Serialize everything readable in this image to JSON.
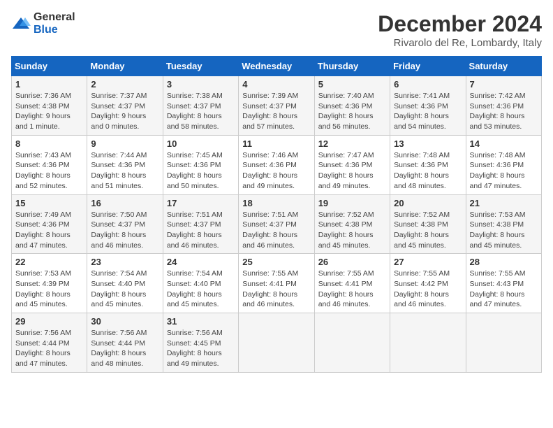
{
  "header": {
    "logo_general": "General",
    "logo_blue": "Blue",
    "title": "December 2024",
    "subtitle": "Rivarolo del Re, Lombardy, Italy"
  },
  "calendar": {
    "columns": [
      "Sunday",
      "Monday",
      "Tuesday",
      "Wednesday",
      "Thursday",
      "Friday",
      "Saturday"
    ],
    "weeks": [
      [
        {
          "day": "1",
          "sunrise": "Sunrise: 7:36 AM",
          "sunset": "Sunset: 4:38 PM",
          "daylight": "Daylight: 9 hours and 1 minute."
        },
        {
          "day": "2",
          "sunrise": "Sunrise: 7:37 AM",
          "sunset": "Sunset: 4:37 PM",
          "daylight": "Daylight: 9 hours and 0 minutes."
        },
        {
          "day": "3",
          "sunrise": "Sunrise: 7:38 AM",
          "sunset": "Sunset: 4:37 PM",
          "daylight": "Daylight: 8 hours and 58 minutes."
        },
        {
          "day": "4",
          "sunrise": "Sunrise: 7:39 AM",
          "sunset": "Sunset: 4:37 PM",
          "daylight": "Daylight: 8 hours and 57 minutes."
        },
        {
          "day": "5",
          "sunrise": "Sunrise: 7:40 AM",
          "sunset": "Sunset: 4:36 PM",
          "daylight": "Daylight: 8 hours and 56 minutes."
        },
        {
          "day": "6",
          "sunrise": "Sunrise: 7:41 AM",
          "sunset": "Sunset: 4:36 PM",
          "daylight": "Daylight: 8 hours and 54 minutes."
        },
        {
          "day": "7",
          "sunrise": "Sunrise: 7:42 AM",
          "sunset": "Sunset: 4:36 PM",
          "daylight": "Daylight: 8 hours and 53 minutes."
        }
      ],
      [
        {
          "day": "8",
          "sunrise": "Sunrise: 7:43 AM",
          "sunset": "Sunset: 4:36 PM",
          "daylight": "Daylight: 8 hours and 52 minutes."
        },
        {
          "day": "9",
          "sunrise": "Sunrise: 7:44 AM",
          "sunset": "Sunset: 4:36 PM",
          "daylight": "Daylight: 8 hours and 51 minutes."
        },
        {
          "day": "10",
          "sunrise": "Sunrise: 7:45 AM",
          "sunset": "Sunset: 4:36 PM",
          "daylight": "Daylight: 8 hours and 50 minutes."
        },
        {
          "day": "11",
          "sunrise": "Sunrise: 7:46 AM",
          "sunset": "Sunset: 4:36 PM",
          "daylight": "Daylight: 8 hours and 49 minutes."
        },
        {
          "day": "12",
          "sunrise": "Sunrise: 7:47 AM",
          "sunset": "Sunset: 4:36 PM",
          "daylight": "Daylight: 8 hours and 49 minutes."
        },
        {
          "day": "13",
          "sunrise": "Sunrise: 7:48 AM",
          "sunset": "Sunset: 4:36 PM",
          "daylight": "Daylight: 8 hours and 48 minutes."
        },
        {
          "day": "14",
          "sunrise": "Sunrise: 7:48 AM",
          "sunset": "Sunset: 4:36 PM",
          "daylight": "Daylight: 8 hours and 47 minutes."
        }
      ],
      [
        {
          "day": "15",
          "sunrise": "Sunrise: 7:49 AM",
          "sunset": "Sunset: 4:36 PM",
          "daylight": "Daylight: 8 hours and 47 minutes."
        },
        {
          "day": "16",
          "sunrise": "Sunrise: 7:50 AM",
          "sunset": "Sunset: 4:37 PM",
          "daylight": "Daylight: 8 hours and 46 minutes."
        },
        {
          "day": "17",
          "sunrise": "Sunrise: 7:51 AM",
          "sunset": "Sunset: 4:37 PM",
          "daylight": "Daylight: 8 hours and 46 minutes."
        },
        {
          "day": "18",
          "sunrise": "Sunrise: 7:51 AM",
          "sunset": "Sunset: 4:37 PM",
          "daylight": "Daylight: 8 hours and 46 minutes."
        },
        {
          "day": "19",
          "sunrise": "Sunrise: 7:52 AM",
          "sunset": "Sunset: 4:38 PM",
          "daylight": "Daylight: 8 hours and 45 minutes."
        },
        {
          "day": "20",
          "sunrise": "Sunrise: 7:52 AM",
          "sunset": "Sunset: 4:38 PM",
          "daylight": "Daylight: 8 hours and 45 minutes."
        },
        {
          "day": "21",
          "sunrise": "Sunrise: 7:53 AM",
          "sunset": "Sunset: 4:38 PM",
          "daylight": "Daylight: 8 hours and 45 minutes."
        }
      ],
      [
        {
          "day": "22",
          "sunrise": "Sunrise: 7:53 AM",
          "sunset": "Sunset: 4:39 PM",
          "daylight": "Daylight: 8 hours and 45 minutes."
        },
        {
          "day": "23",
          "sunrise": "Sunrise: 7:54 AM",
          "sunset": "Sunset: 4:40 PM",
          "daylight": "Daylight: 8 hours and 45 minutes."
        },
        {
          "day": "24",
          "sunrise": "Sunrise: 7:54 AM",
          "sunset": "Sunset: 4:40 PM",
          "daylight": "Daylight: 8 hours and 45 minutes."
        },
        {
          "day": "25",
          "sunrise": "Sunrise: 7:55 AM",
          "sunset": "Sunset: 4:41 PM",
          "daylight": "Daylight: 8 hours and 46 minutes."
        },
        {
          "day": "26",
          "sunrise": "Sunrise: 7:55 AM",
          "sunset": "Sunset: 4:41 PM",
          "daylight": "Daylight: 8 hours and 46 minutes."
        },
        {
          "day": "27",
          "sunrise": "Sunrise: 7:55 AM",
          "sunset": "Sunset: 4:42 PM",
          "daylight": "Daylight: 8 hours and 46 minutes."
        },
        {
          "day": "28",
          "sunrise": "Sunrise: 7:55 AM",
          "sunset": "Sunset: 4:43 PM",
          "daylight": "Daylight: 8 hours and 47 minutes."
        }
      ],
      [
        {
          "day": "29",
          "sunrise": "Sunrise: 7:56 AM",
          "sunset": "Sunset: 4:44 PM",
          "daylight": "Daylight: 8 hours and 47 minutes."
        },
        {
          "day": "30",
          "sunrise": "Sunrise: 7:56 AM",
          "sunset": "Sunset: 4:44 PM",
          "daylight": "Daylight: 8 hours and 48 minutes."
        },
        {
          "day": "31",
          "sunrise": "Sunrise: 7:56 AM",
          "sunset": "Sunset: 4:45 PM",
          "daylight": "Daylight: 8 hours and 49 minutes."
        },
        null,
        null,
        null,
        null
      ]
    ]
  }
}
